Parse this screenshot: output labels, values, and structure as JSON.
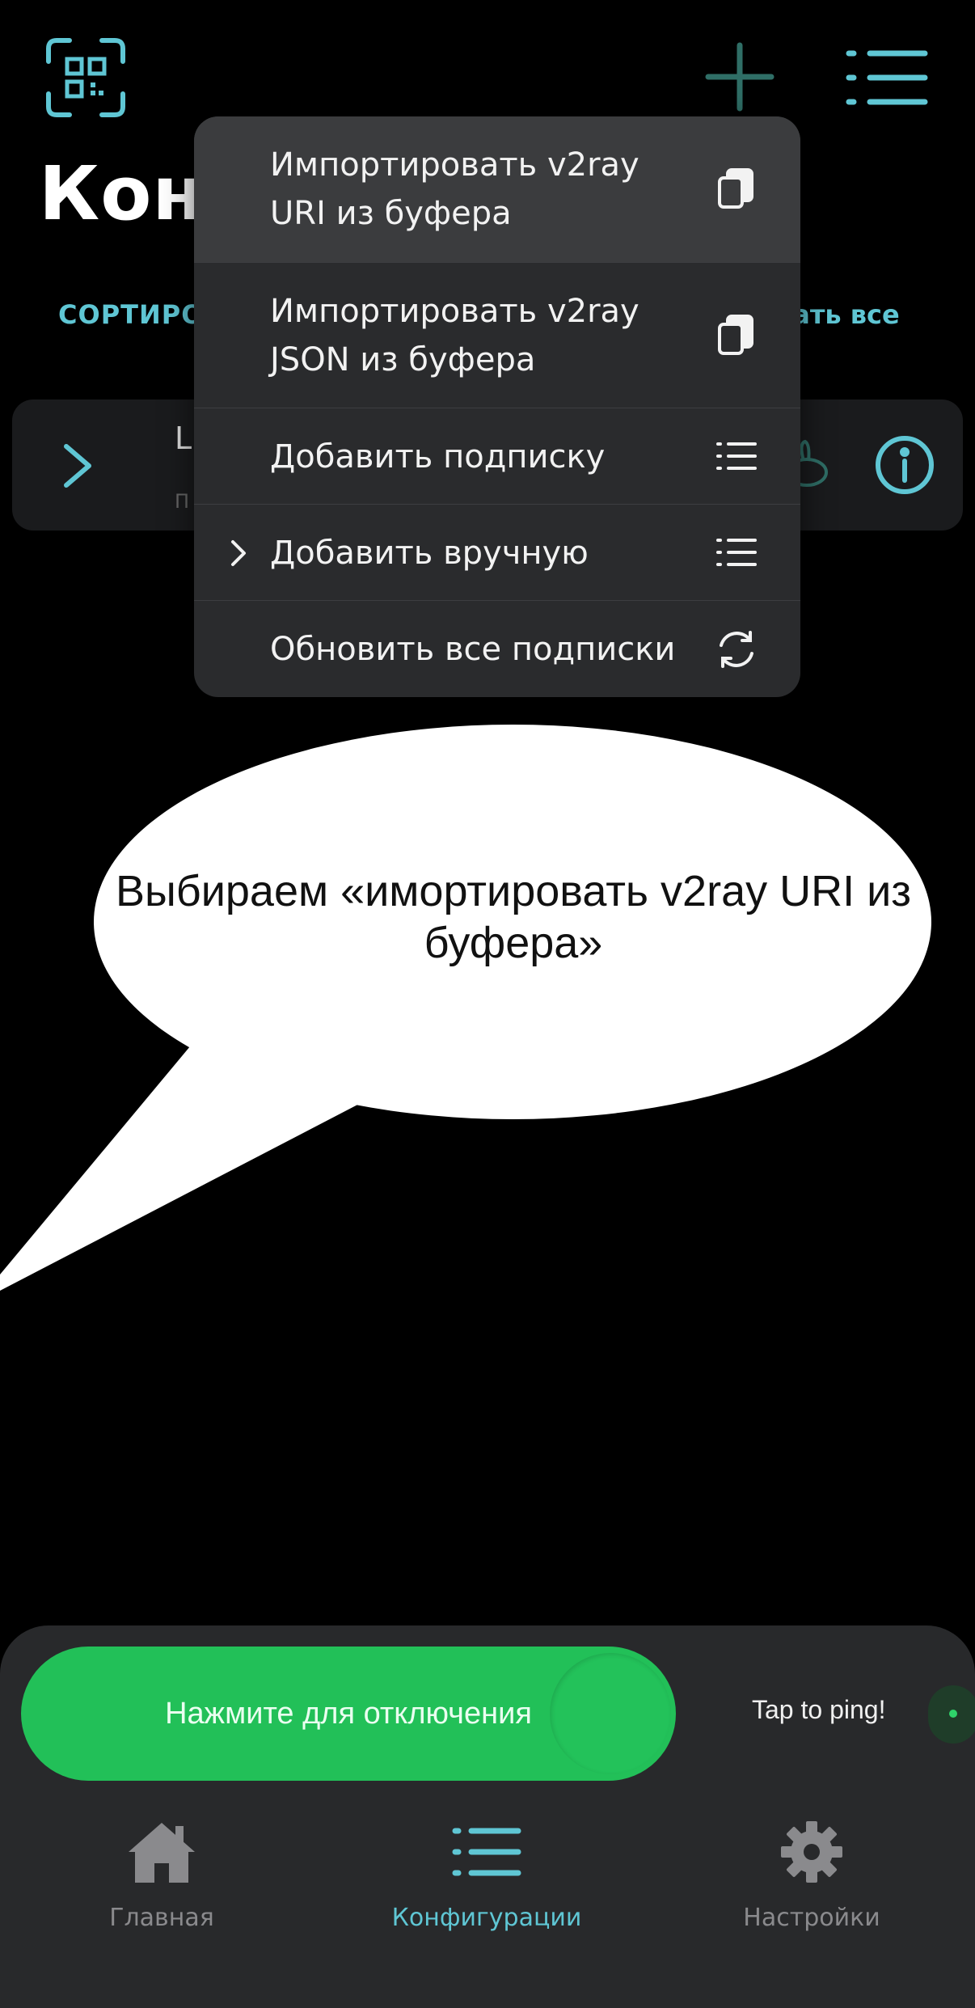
{
  "header": {
    "title": "Конф",
    "sort_label": "СОРТИРОВАТЬ",
    "select_all_label": "вать все"
  },
  "config_card": {
    "title": "L",
    "subtitle": "П"
  },
  "popup": {
    "items": [
      {
        "label": "Импортировать v2ray\nURI из буфера",
        "icon": "clipboard-icon"
      },
      {
        "label": "Импортировать v2ray\nJSON из буфера",
        "icon": "clipboard-icon"
      },
      {
        "label": "Добавить подписку",
        "icon": "list-icon"
      },
      {
        "label": "Добавить вручную",
        "icon": "list-icon"
      },
      {
        "label": "Обновить все подписки",
        "icon": "refresh-icon"
      }
    ]
  },
  "annotation": {
    "text": "Выбираем «имортировать v2ray URI из буфера»"
  },
  "connect": {
    "label": "Нажмите для отключения",
    "ping_label": "Tap to ping!"
  },
  "tabs": [
    {
      "label": "Главная",
      "icon": "home-icon"
    },
    {
      "label": "Конфигурации",
      "icon": "list-icon"
    },
    {
      "label": "Настройки",
      "icon": "gear-icon"
    }
  ],
  "colors": {
    "accent": "#5fc6d4",
    "connect_green": "#22c058",
    "background": "#000000"
  }
}
